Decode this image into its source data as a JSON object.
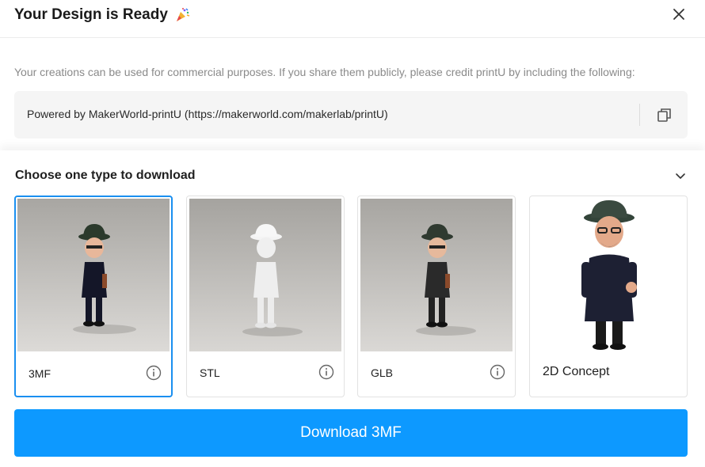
{
  "header": {
    "title": "Your Design is Ready",
    "title_icon": "party-popper-icon",
    "close_icon": "close-icon"
  },
  "notice": "Your creations can be used for commercial purposes. If you share them publicly, please credit printU by including the following:",
  "credit": {
    "text": "Powered by MakerWorld-printU (https://makerworld.com/makerlab/printU)",
    "copy_icon": "copy-icon"
  },
  "download_section": {
    "title": "Choose one type to download",
    "toggle_icon": "chevron-down-icon",
    "options": [
      {
        "label": "3MF",
        "selected": true,
        "icon": "info-icon"
      },
      {
        "label": "STL",
        "selected": false,
        "icon": "info-icon"
      },
      {
        "label": "GLB",
        "selected": false,
        "icon": "info-icon"
      },
      {
        "label": "2D Concept",
        "selected": false
      }
    ],
    "button_label": "Download 3MF"
  },
  "colors": {
    "accent": "#0d99ff",
    "selected_border": "#1a8ff0"
  }
}
